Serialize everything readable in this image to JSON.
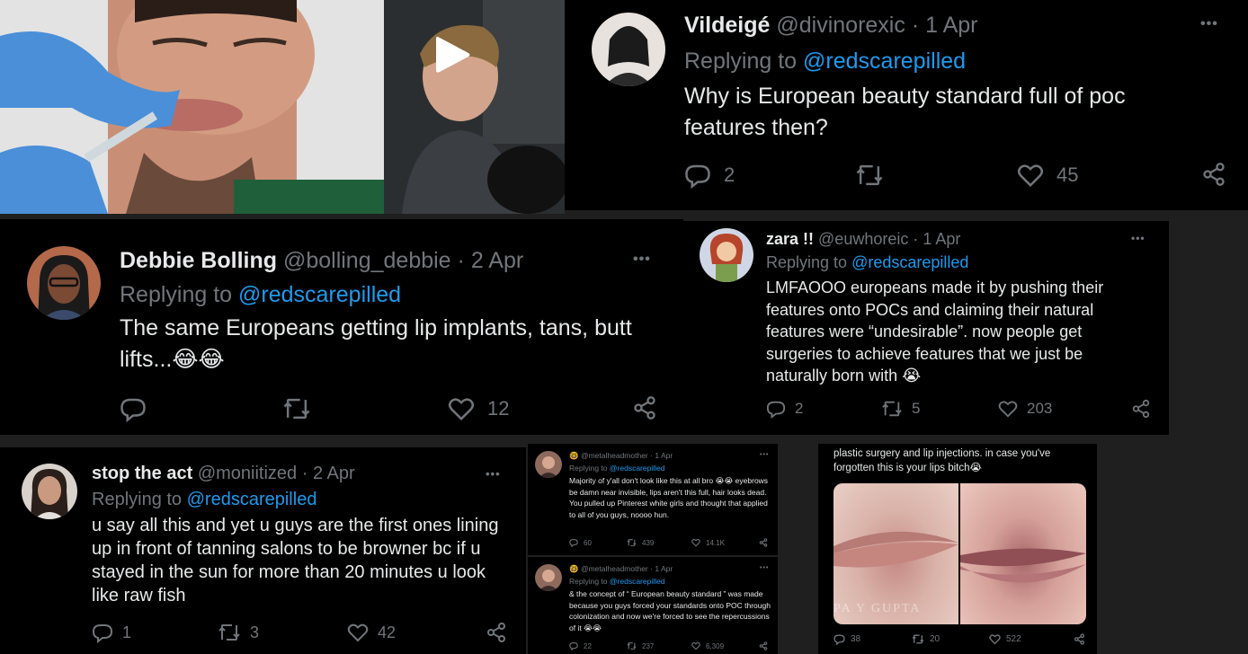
{
  "video": {
    "play_label": "Play"
  },
  "t1": {
    "name": "Vildeigé",
    "handle": "@divinorexic",
    "date": "1 Apr",
    "replying": "Replying to",
    "reply_to": "@redscarepilled",
    "text": "Why is European beauty standard full of poc features then?",
    "replies": "2",
    "reposts": "",
    "likes": "45",
    "more": "•••"
  },
  "t2": {
    "name": "Debbie Bolling",
    "handle": "@bolling_debbie",
    "date": "2 Apr",
    "replying": "Replying to",
    "reply_to": "@redscarepilled",
    "text": "The same Europeans getting lip implants, tans, butt lifts...😂😂",
    "replies": "",
    "reposts": "",
    "likes": "12",
    "more": "•••"
  },
  "t3": {
    "name": "zara !!",
    "handle": "@euwhoreic",
    "date": "1 Apr",
    "replying": "Replying to",
    "reply_to": "@redscarepilled",
    "text": "LMFAOOO europeans made it by pushing their features onto POCs and claiming their natural features were “undesirable”. now people get surgeries to achieve features that we just be naturally born with 😭",
    "replies": "2",
    "reposts": "5",
    "likes": "203",
    "more": "•••"
  },
  "t4": {
    "name": "stop the act",
    "handle": "@moniitized",
    "date": "2 Apr",
    "replying": "Replying to",
    "reply_to": "@redscarepilled",
    "text": "u say all this and yet u guys are the first ones lining up in front of tanning salons to be browner bc if u stayed in the sun for more than 20 minutes u look like raw fish",
    "replies": "1",
    "reposts": "3",
    "likes": "42",
    "more": "•••"
  },
  "t5": {
    "name": "🤓",
    "handle": "@metalheadmother",
    "date": "1 Apr",
    "replying": "Replying to",
    "reply_to": "@redscarepilled",
    "text": "Majority of y'all don't look like this at all bro 😭😭 eyebrows be damn near invisible, lips aren't this full, hair looks dead. You pulled up Pinterest white girls and thought that applied to all of you guys, noooo hun.",
    "replies": "60",
    "reposts": "439",
    "likes": "14.1K",
    "more": "•••"
  },
  "t6": {
    "name": "🤓",
    "handle": "@metalheadmother",
    "date": "1 Apr",
    "replying": "Replying to",
    "reply_to": "@redscarepilled",
    "text": "& the concept of “ European beauty standard ” was made because you guys forced your standards onto POC through colonization and now we're forced to see the repercussions of it 😭😭",
    "replies": "22",
    "reposts": "237",
    "likes": "6,309",
    "more": "•••"
  },
  "t7": {
    "text": "plastic surgery and lip injections. in case you've forgotten this is your lips bitch😭",
    "watermark": "PA Y GUPTA",
    "replies": "38",
    "reposts": "20",
    "likes": "522"
  }
}
